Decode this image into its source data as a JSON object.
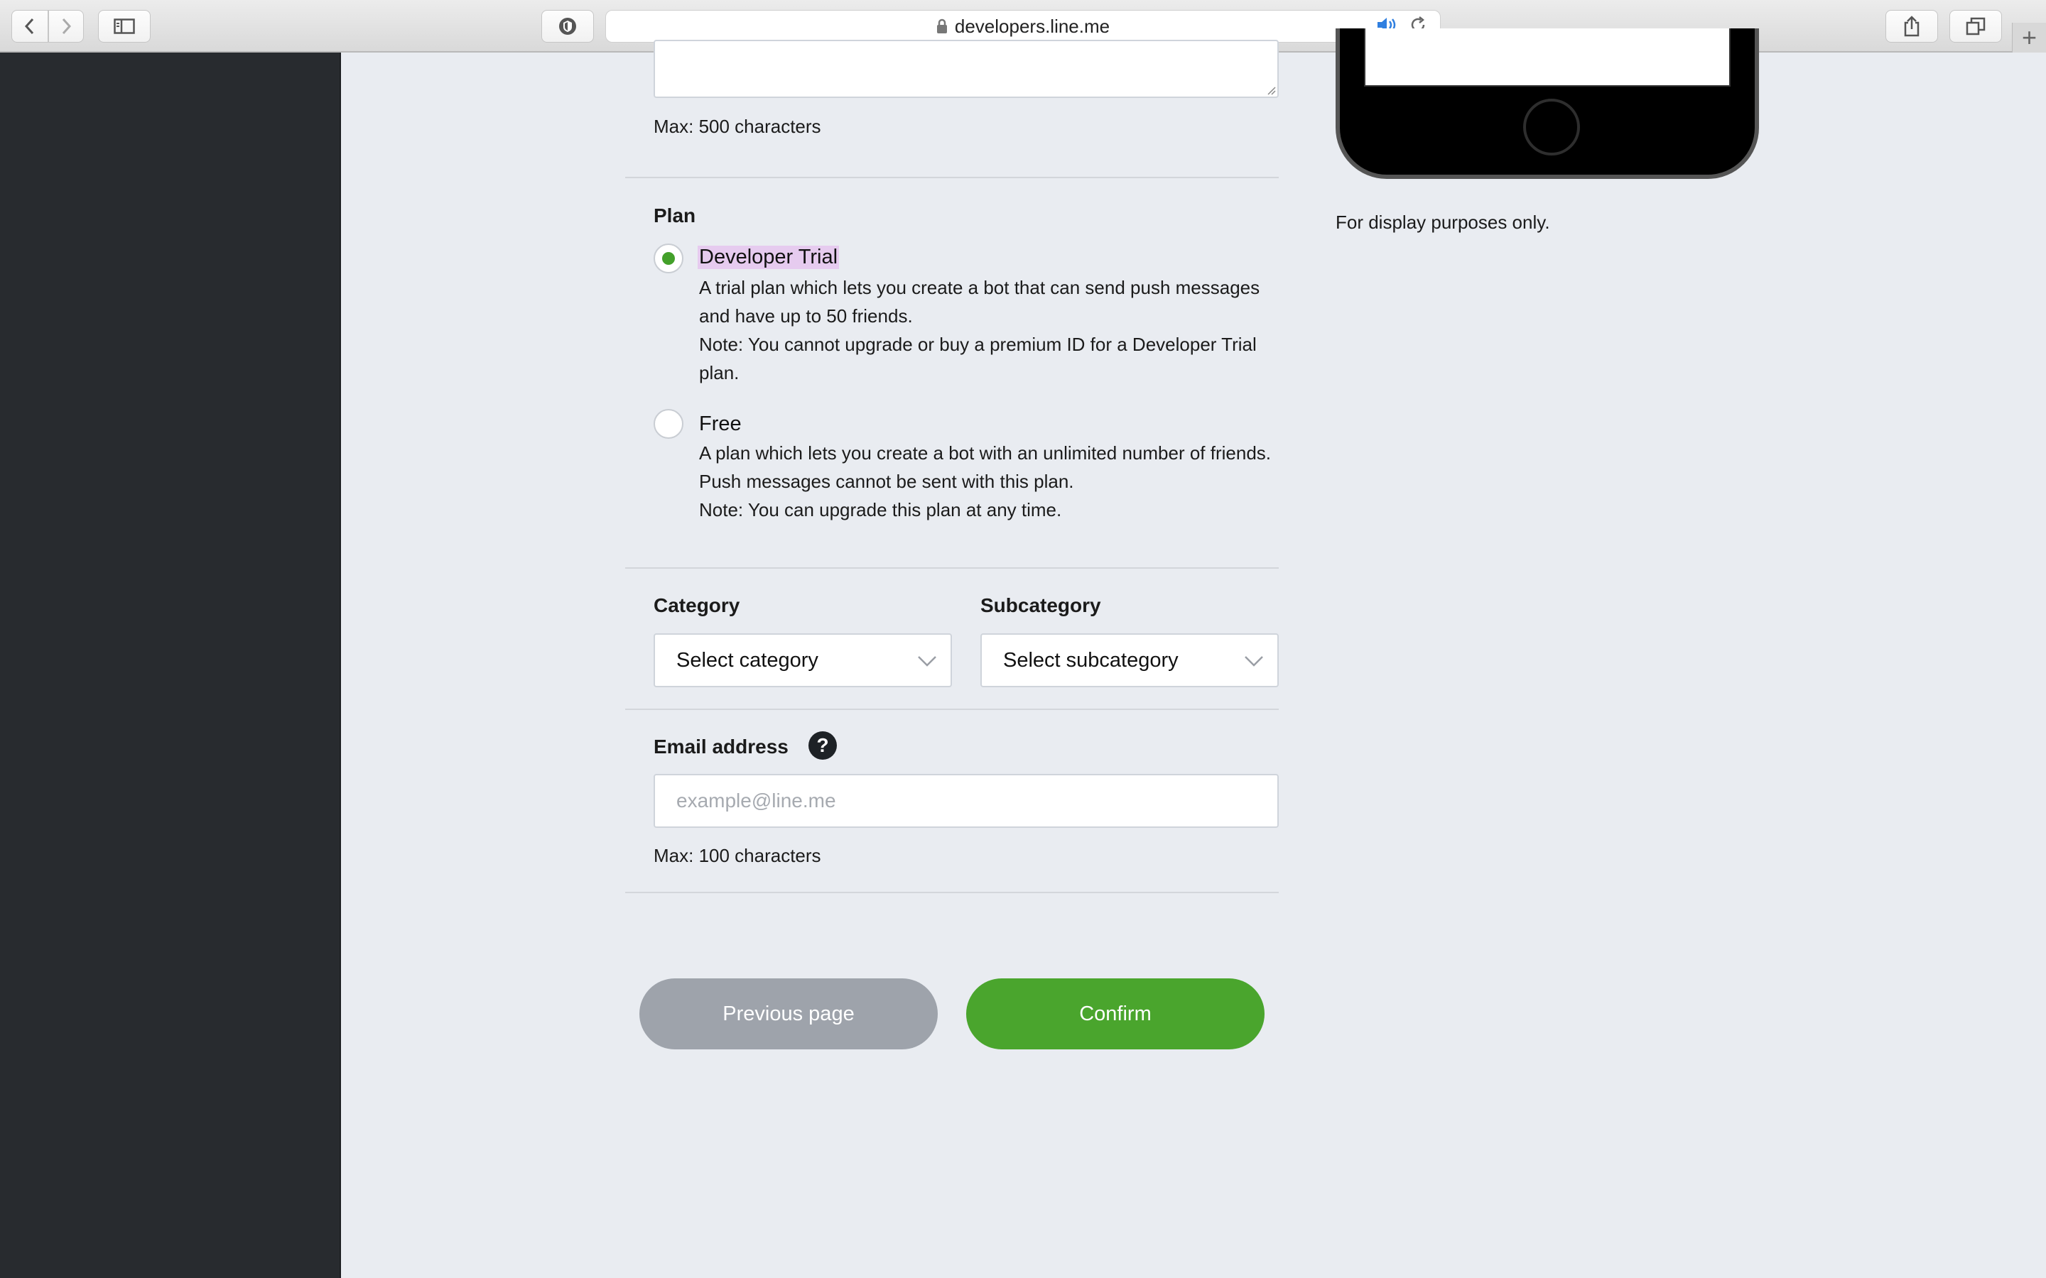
{
  "browser": {
    "url": "developers.line.me",
    "new_tab_label": "+"
  },
  "form": {
    "description_hint": "Max: 500 characters",
    "plan": {
      "label": "Plan",
      "options": [
        {
          "title": "Developer Trial",
          "selected": true,
          "desc_line1": "A trial plan which lets you create a bot that can send push messages and have up to 50 friends.",
          "desc_line2": "Note: You cannot upgrade or buy a premium ID for a Developer Trial plan."
        },
        {
          "title": "Free",
          "selected": false,
          "desc_line1": "A plan which lets you create a bot with an unlimited number of friends. Push messages cannot be sent with this plan.",
          "desc_line2": "Note: You can upgrade this plan at any time."
        }
      ]
    },
    "category": {
      "label": "Category",
      "value": "Select category"
    },
    "subcategory": {
      "label": "Subcategory",
      "value": "Select subcategory"
    },
    "email": {
      "label": "Email address",
      "help_glyph": "?",
      "placeholder": "example@line.me",
      "hint": "Max: 100 characters"
    },
    "buttons": {
      "previous": "Previous page",
      "confirm": "Confirm"
    }
  },
  "preview": {
    "note": "For display purposes only."
  },
  "colors": {
    "accent_green": "#4aa52d",
    "radio_selected": "#43a02a",
    "secondary_button": "#9ea3ab",
    "sidebar": "#282b2f",
    "page_bg": "#e9ecf1",
    "highlight": "#e6cbef"
  }
}
